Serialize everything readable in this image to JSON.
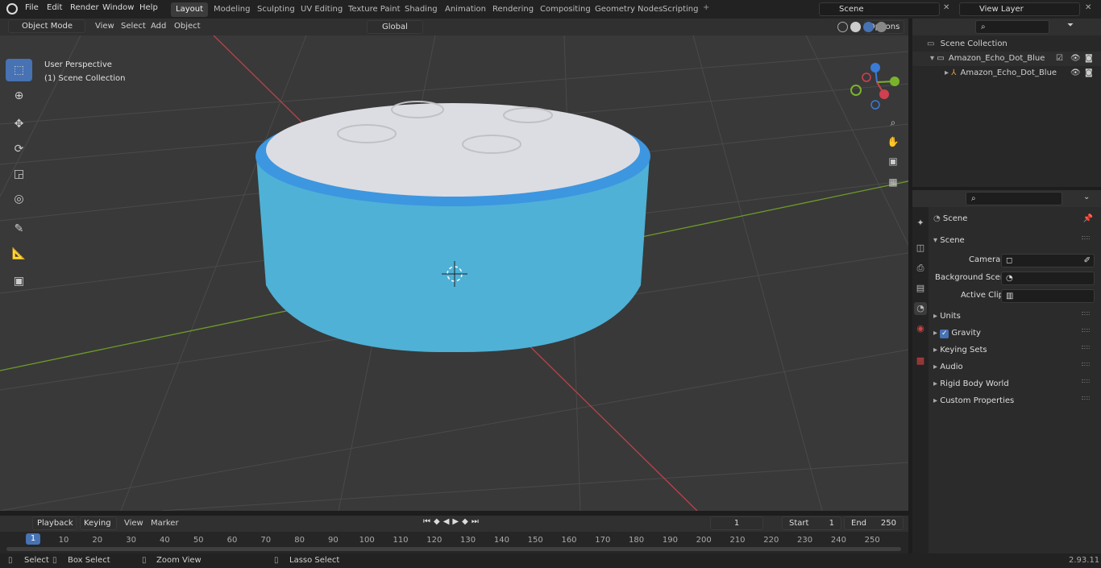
{
  "menu": [
    "File",
    "Edit",
    "Render",
    "Window",
    "Help"
  ],
  "workspaces": [
    "Layout",
    "Modeling",
    "Sculpting",
    "UV Editing",
    "Texture Paint",
    "Shading",
    "Animation",
    "Rendering",
    "Compositing",
    "Geometry Nodes",
    "Scripting"
  ],
  "scene_name": "Scene",
  "view_layer": "View Layer",
  "viewport_header": {
    "mode": "Object Mode",
    "menus": [
      "View",
      "Select",
      "Add",
      "Object"
    ],
    "transform": "Global",
    "options": "Options"
  },
  "overlay": {
    "perspective": "User Perspective",
    "collection": "(1) Scene Collection"
  },
  "outliner": {
    "root": "Scene Collection",
    "collection": "Amazon_Echo_Dot_Blue",
    "object": "Amazon_Echo_Dot_Blue"
  },
  "properties": {
    "context": "Scene",
    "panel": "Scene",
    "camera_label": "Camera",
    "bg_scene_label": "Background Scene",
    "active_clip_label": "Active Clip",
    "sections": [
      "Units",
      "Gravity",
      "Keying Sets",
      "Audio",
      "Rigid Body World",
      "Custom Properties"
    ]
  },
  "timeline": {
    "menus": [
      "Playback",
      "Keying",
      "View",
      "Marker"
    ],
    "current_frame": "1",
    "start_label": "Start",
    "start": "1",
    "end_label": "End",
    "end": "250",
    "ticks": [
      "10",
      "20",
      "30",
      "40",
      "50",
      "60",
      "70",
      "80",
      "90",
      "100",
      "110",
      "120",
      "130",
      "140",
      "150",
      "160",
      "170",
      "180",
      "190",
      "200",
      "210",
      "220",
      "230",
      "240",
      "250"
    ]
  },
  "statusbar": {
    "select": "Select",
    "box_select": "Box Select",
    "zoom_view": "Zoom View",
    "lasso_select": "Lasso Select",
    "version": "2.93.11"
  },
  "colors": {
    "accent": "#4772b3",
    "x_axis": "#d04050",
    "y_axis": "#7ab32b",
    "z_axis": "#3a7bd5",
    "echo_body": "#4ab3d8",
    "echo_top": "#dcdde2"
  }
}
